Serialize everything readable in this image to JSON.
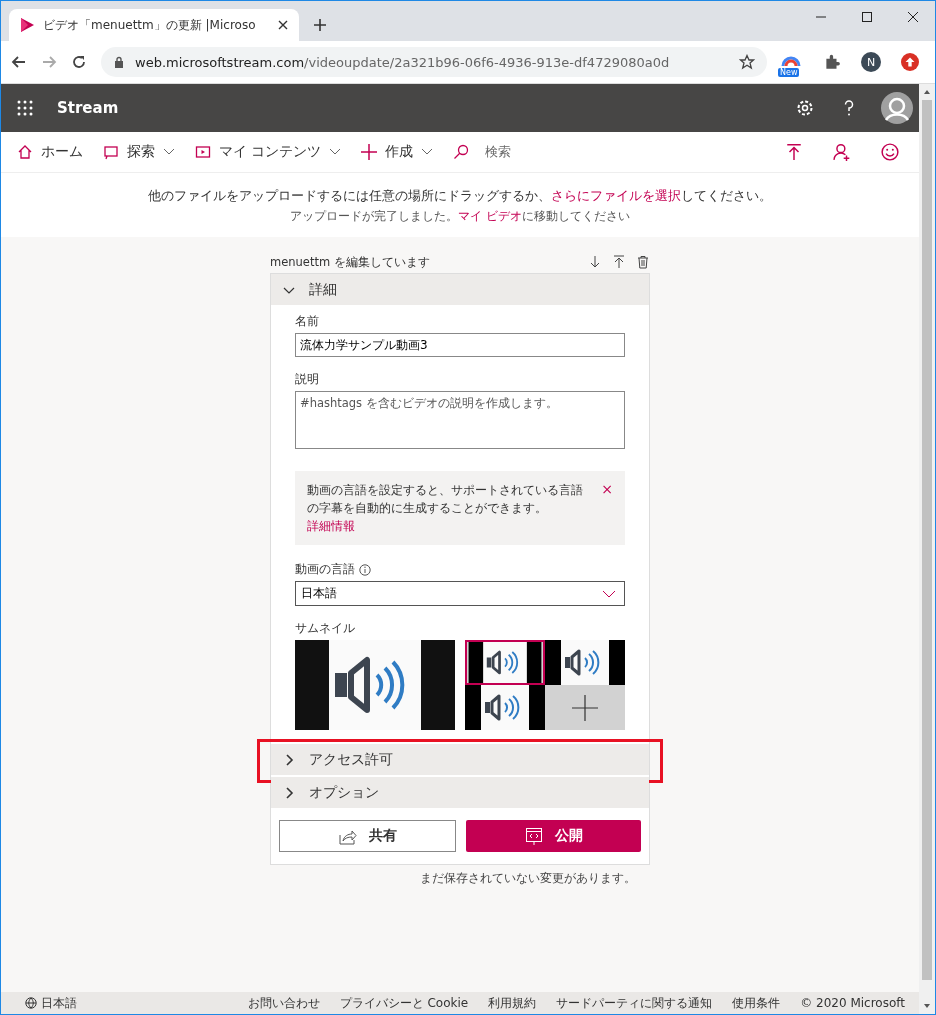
{
  "browser": {
    "tab_title": "ビデオ「menuettm」の更新 |Microso",
    "url_host": "web.microsoftstream.com",
    "url_path": "/videoupdate/2a321b96-06f6-4936-913e-df4729080a0d",
    "extension_badge": "New",
    "profile_initial": "N"
  },
  "app": {
    "title": "Stream"
  },
  "nav": [
    {
      "label": "ホーム",
      "dropdown": false
    },
    {
      "label": "探索",
      "dropdown": true
    },
    {
      "label": "マイ コンテンツ",
      "dropdown": true
    },
    {
      "label": "作成",
      "dropdown": true
    },
    {
      "label": "検索",
      "dropdown": false
    }
  ],
  "banner": {
    "line1": "他のファイルをアップロードするには任意の場所にドラッグするか、",
    "line1_link": "さらにファイルを選択",
    "line1_end": "してください。",
    "line2": "アップロードが完了しました。",
    "line2_link": "マイ ビデオ",
    "line2_end": "に移動してください"
  },
  "editor": {
    "heading": "menuettm を編集しています",
    "sections": [
      {
        "label": "詳細",
        "expanded": true,
        "highlighted": false
      },
      {
        "label": "アクセス許可",
        "expanded": false,
        "highlighted": true
      },
      {
        "label": "オプション",
        "expanded": false,
        "highlighted": false
      }
    ],
    "name_label": "名前",
    "name_value": "流体力学サンプル動画3",
    "description_label": "説明",
    "description_placeholder": "#hashtags を含むビデオの説明を作成します。",
    "notice": {
      "text": "動画の言語を設定すると、サポートされている言語の字幕を自動的に生成することができます。",
      "link": "詳細情報",
      "close": "×"
    },
    "language_label": "動画の言語",
    "language_value": "日本語",
    "thumbnail_label": "サムネイル",
    "thumbnails": [
      {
        "kind": "image",
        "selected": true
      },
      {
        "kind": "image",
        "selected": false
      },
      {
        "kind": "image",
        "selected": false
      },
      {
        "kind": "add",
        "selected": false
      }
    ],
    "share_button": "共有",
    "publish_button": "公開",
    "unsaved_note": "まだ保存されていない変更があります。"
  },
  "footer": [
    "日本語",
    "お問い合わせ",
    "プライバシーと Cookie",
    "利用規約",
    "サードパーティに関する通知",
    "使用条件",
    "© 2020 Microsoft"
  ]
}
